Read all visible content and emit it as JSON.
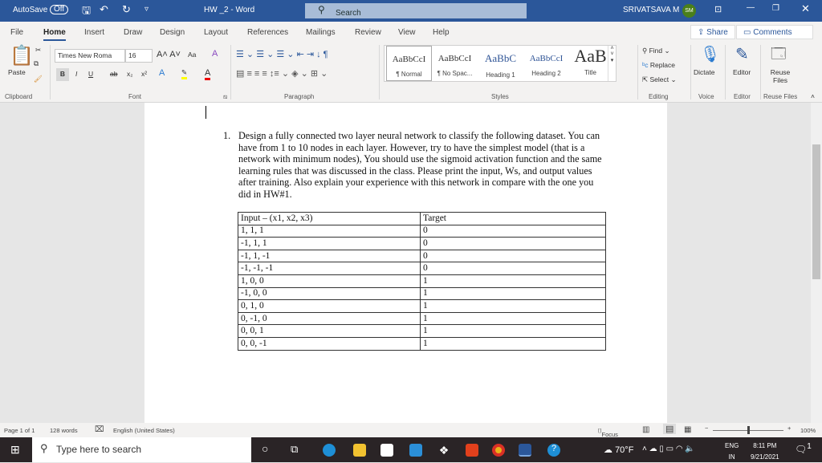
{
  "titlebar": {
    "autosave_label": "AutoSave",
    "autosave_state": "Off",
    "doc_title": "HW _2  -  Word",
    "search_placeholder": "Search",
    "user_name": "SRIVATSAVA M",
    "user_initials": "SM"
  },
  "tabs": [
    "File",
    "Home",
    "Insert",
    "Draw",
    "Design",
    "Layout",
    "References",
    "Mailings",
    "Review",
    "View",
    "Help"
  ],
  "active_tab": "Home",
  "header_buttons": {
    "share": "Share",
    "comments": "Comments"
  },
  "ribbon": {
    "clipboard": {
      "paste": "Paste",
      "label": "Clipboard"
    },
    "font": {
      "name": "Times New Roma",
      "size": "16",
      "change_case": "Aa",
      "label": "Font",
      "bold": "B",
      "italic": "I",
      "underline": "U",
      "strike": "ab"
    },
    "paragraph": {
      "label": "Paragraph"
    },
    "styles": {
      "label": "Styles",
      "items": [
        {
          "preview": "AaBbCcI",
          "name": "¶ Normal"
        },
        {
          "preview": "AaBbCcI",
          "name": "¶ No Spac..."
        },
        {
          "preview": "AaBbC",
          "name": "Heading 1"
        },
        {
          "preview": "AaBbCcI",
          "name": "Heading 2"
        },
        {
          "preview": "AaB",
          "name": "Title"
        }
      ]
    },
    "editing": {
      "find": "Find",
      "replace": "Replace",
      "select": "Select",
      "label": "Editing"
    },
    "voice": {
      "dictate": "Dictate",
      "label": "Voice"
    },
    "editor": {
      "editor": "Editor",
      "label": "Editor"
    },
    "reuse": {
      "button": "Reuse Files",
      "label": "Reuse Files"
    }
  },
  "document": {
    "item_number": "1.",
    "paragraph": "Design a fully connected two layer neural network to classify the following dataset. You can have from 1 to 10 nodes in each layer. However, try to have the simplest model (that is a network with minimum nodes), You should use the sigmoid activation function and the same learning rules that was discussed in the class. Please print the input, Ws,  and output values after training. Also explain your experience with this network in compare with the one you did in HW#1.",
    "table": {
      "headers": [
        "Input – (x1, x2, x3)",
        "Target"
      ],
      "rows": [
        [
          "1, 1, 1",
          "0"
        ],
        [
          "-1, 1, 1",
          "0"
        ],
        [
          "-1, 1, -1",
          "0"
        ],
        [
          "-1, -1, -1",
          "0"
        ],
        [
          "1, 0, 0",
          "1"
        ],
        [
          "-1, 0, 0",
          "1"
        ],
        [
          "0, 1, 0",
          "1"
        ],
        [
          "0, -1, 0",
          "1"
        ],
        [
          "0, 0, 1",
          "1"
        ],
        [
          "0, 0, -1",
          "1"
        ]
      ]
    }
  },
  "statusbar": {
    "page": "Page 1 of 1",
    "words": "128 words",
    "language": "English (United States)",
    "focus": "Focus",
    "zoom": "100%",
    "zoom_level_percent": 100
  },
  "taskbar": {
    "search_placeholder": "Type here to search",
    "weather": "70°F",
    "lang_top": "ENG",
    "lang_bottom": "IN",
    "time": "8:11 PM",
    "date": "9/21/2021",
    "notifications": "1"
  },
  "colors": {
    "word_blue": "#2b579a",
    "taskbar": "#2a2426"
  }
}
